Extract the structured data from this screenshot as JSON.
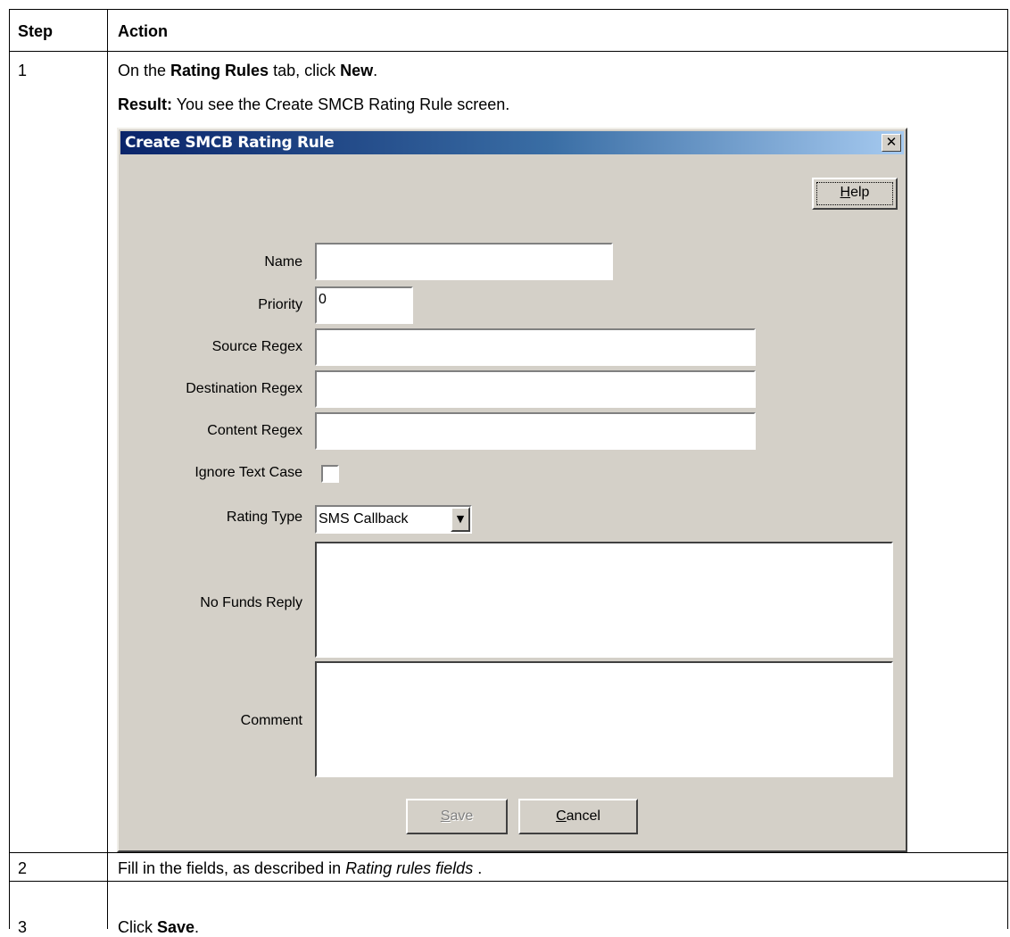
{
  "table": {
    "header": {
      "step": "Step",
      "action": "Action"
    },
    "rows": [
      {
        "step": "1",
        "line1": {
          "pre": "On the ",
          "bold1": "Rating Rules",
          "mid": " tab, click ",
          "bold2": "New",
          "post": "."
        },
        "line2": {
          "bold": "Result:",
          "text": " You see the Create SMCB Rating Rule screen."
        }
      },
      {
        "step": "2",
        "line": {
          "pre": "Fill in the fields, as described in ",
          "italic": "Rating rules fields",
          "post": " ."
        }
      },
      {
        "step": "3",
        "line": {
          "pre": "Click ",
          "bold": "Save",
          "post": "."
        }
      }
    ]
  },
  "dialog": {
    "title": "Create SMCB Rating Rule",
    "close_glyph": "✕",
    "help_label": {
      "pre": "",
      "u": "H",
      "post": "elp"
    },
    "fields": {
      "name": {
        "label": "Name",
        "value": ""
      },
      "priority": {
        "label": "Priority",
        "value": "0"
      },
      "source_regex": {
        "label": "Source Regex",
        "value": ""
      },
      "destination_regex": {
        "label": "Destination Regex",
        "value": ""
      },
      "content_regex": {
        "label": "Content Regex",
        "value": ""
      },
      "ignore_text_case": {
        "label": "Ignore Text Case",
        "checked": false
      },
      "rating_type": {
        "label": "Rating Type",
        "value": "SMS Callback",
        "arrow": "▼"
      },
      "no_funds_reply": {
        "label": "No Funds Reply",
        "value": ""
      },
      "comment": {
        "label": "Comment",
        "value": ""
      }
    },
    "save_label": {
      "u": "S",
      "post": "ave"
    },
    "cancel_label": {
      "u": "C",
      "post": "ancel"
    }
  }
}
